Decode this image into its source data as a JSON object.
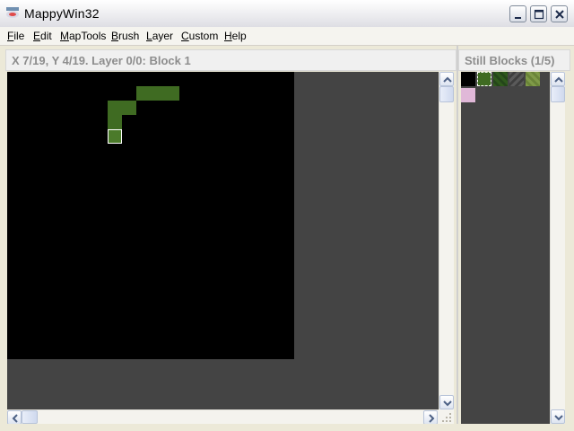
{
  "window": {
    "title": "MappyWin32",
    "icon": "mappy-app-icon",
    "controls": [
      "minimize-icon",
      "maximize-icon",
      "close-icon"
    ]
  },
  "menu": {
    "items": [
      {
        "label": "File",
        "accel": "F"
      },
      {
        "label": "Edit",
        "accel": "E"
      },
      {
        "label": "MapTools",
        "accel": "M"
      },
      {
        "label": "Brush",
        "accel": "B"
      },
      {
        "label": "Layer",
        "accel": "L"
      },
      {
        "label": "Custom",
        "accel": "C"
      },
      {
        "label": "Help",
        "accel": "H"
      }
    ]
  },
  "map_panel": {
    "status": "X 7/19, Y 4/19. Layer 0/0: Block 1"
  },
  "blocks_panel": {
    "title": "Still Blocks (1/5)",
    "block_colors": [
      "#000000",
      "#3f6b22",
      "#2f5a1c",
      "#555555",
      "#7f9a48",
      "#e0b8d8"
    ]
  },
  "colors": {
    "map_background": "#000000",
    "workspace": "#444444",
    "grass_tile": "#3f6b22"
  }
}
